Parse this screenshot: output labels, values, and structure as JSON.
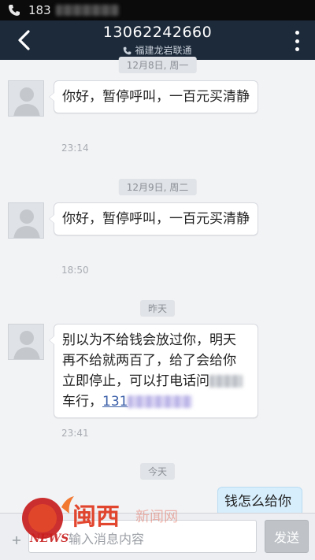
{
  "status_bar": {
    "number_prefix": "183"
  },
  "header": {
    "title": "13062242660",
    "subtitle": "福建龙岩联通"
  },
  "messages": [
    {
      "date": "12月8日, 周一",
      "text": "你好，暂停呼叫，一百元买清静",
      "time": "23:14"
    },
    {
      "date": "12月9日, 周二",
      "text": "你好，暂停呼叫，一百元买清静",
      "time": "18:50"
    },
    {
      "date": "昨天",
      "text_line1": "别以为不给钱会放过你，明天",
      "text_line2": "再不给就两百了，给了会给你",
      "text_line3": "立即停止，可以打电话问",
      "text_line4": "车行，",
      "link_prefix": "131",
      "time": "23:41"
    },
    {
      "date": "今天",
      "outgoing_text": "钱怎么给你"
    }
  ],
  "input": {
    "placeholder": "输入消息内容",
    "send_label": "发送"
  },
  "watermark": {
    "brand_cn": "闽西",
    "brand_en": "NEWS",
    "site": "新闻网"
  },
  "colors": {
    "header_bg": "#1d2a3a",
    "link": "#3b5fa8",
    "outgoing_bubble": "#d7eefc"
  }
}
